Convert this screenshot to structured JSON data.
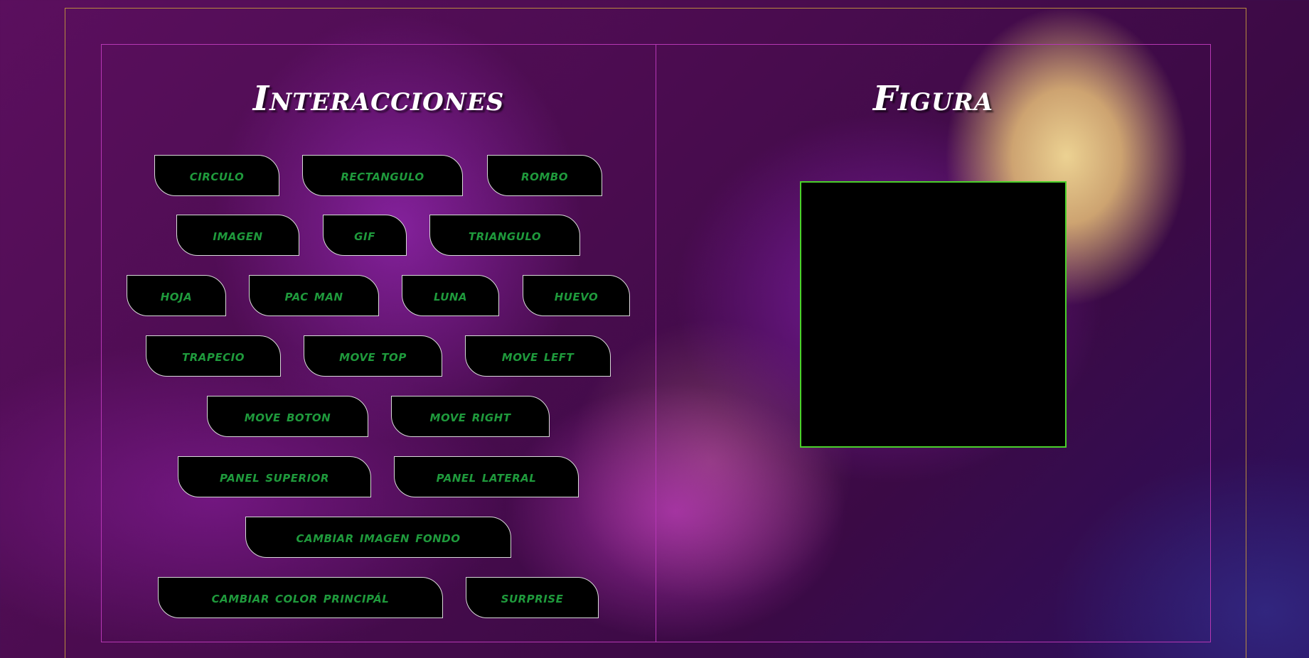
{
  "interactions": {
    "title": "Interacciones",
    "buttons": [
      "CIRCULO",
      "RECTANGULO",
      "ROMBO",
      "IMAGEN",
      "GIF",
      "TRIANGULO",
      "HOJA",
      "PAC MAN",
      "LUNA",
      "HUEVO",
      "TRAPECIO",
      "MOVE TOP",
      "MOVE LEFT",
      "MOVE BOTON",
      "MOVE RIGHT",
      "PANEL SUPERIOR",
      "PANEL LATERAL",
      "CAMBIAR IMAGEN FONDO",
      "CAMBIAR COLOR PRINCIPÁL",
      "SURPRISE"
    ]
  },
  "figure": {
    "title": "Figura"
  },
  "colors": {
    "button_text": "#1f9a3c",
    "button_bg": "#000000",
    "figure_border": "#4ad12a",
    "panel_border": "#b637b4",
    "outer_border": "#b98a3f"
  }
}
